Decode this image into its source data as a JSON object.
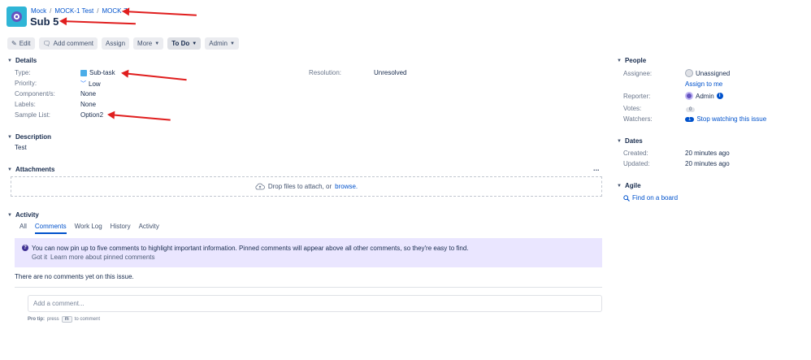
{
  "breadcrumb": [
    "Mock",
    "MOCK-1 Test",
    "MOCK-7"
  ],
  "issue": {
    "title": "Sub 5"
  },
  "toolbar": {
    "edit": "Edit",
    "add_comment": "Add comment",
    "assign": "Assign",
    "more": "More",
    "status": "To Do",
    "admin": "Admin"
  },
  "details": {
    "header": "Details",
    "type_label": "Type:",
    "type_value": "Sub-task",
    "priority_label": "Priority:",
    "priority_value": "Low",
    "components_label": "Component/s:",
    "components_value": "None",
    "labels_label": "Labels:",
    "labels_value": "None",
    "sample_list_label": "Sample List:",
    "sample_list_value": "Option2",
    "resolution_label": "Resolution:",
    "resolution_value": "Unresolved"
  },
  "description": {
    "header": "Description",
    "text": "Test"
  },
  "attachments": {
    "header": "Attachments",
    "more": "...",
    "drop_text": "Drop files to attach, or",
    "browse": "browse."
  },
  "activity": {
    "header": "Activity",
    "tabs": [
      "All",
      "Comments",
      "Work Log",
      "History",
      "Activity"
    ],
    "active_tab": "Comments",
    "info_text": "You can now pin up to five comments to highlight important information. Pinned comments will appear above all other comments, so they're easy to find.",
    "got_it": "Got it",
    "learn_more": "Learn more about pinned comments",
    "no_comments": "There are no comments yet on this issue.",
    "comment_placeholder": "Add a comment...",
    "pro_tip_label": "Pro tip:",
    "pro_tip_press": "press",
    "pro_tip_key": "m",
    "pro_tip_suffix": "to comment"
  },
  "people": {
    "header": "People",
    "assignee_label": "Assignee:",
    "assignee_value": "Unassigned",
    "assign_to_me": "Assign to me",
    "reporter_label": "Reporter:",
    "reporter_value": "Admin",
    "votes_label": "Votes:",
    "votes_value": "0",
    "watchers_label": "Watchers:",
    "watchers_count": "1",
    "watchers_action": "Stop watching this issue"
  },
  "dates": {
    "header": "Dates",
    "created_label": "Created:",
    "created_value": "20 minutes ago",
    "updated_label": "Updated:",
    "updated_value": "20 minutes ago"
  },
  "agile": {
    "header": "Agile",
    "find_on_board": "Find on a board"
  },
  "colors": {
    "accent": "#0052cc",
    "annotation": "#e01e1e",
    "info_bg": "#eae6ff"
  }
}
